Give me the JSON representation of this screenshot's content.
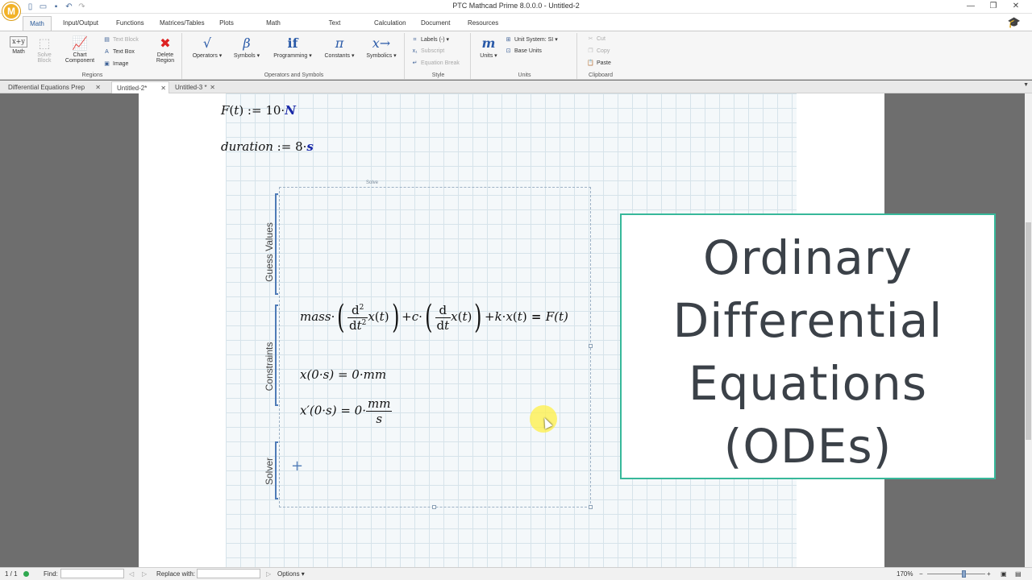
{
  "window": {
    "title": "PTC Mathcad Prime 8.0.0.0 - Untitled-2",
    "logo_letter": "M"
  },
  "ribbon_tabs": [
    {
      "label": "Math",
      "active": true
    },
    {
      "label": "Input/Output"
    },
    {
      "label": "Functions"
    },
    {
      "label": "Matrices/Tables"
    },
    {
      "label": "Plots"
    },
    {
      "label": "Math Formatting"
    },
    {
      "label": "Text Formatting"
    },
    {
      "label": "Calculation"
    },
    {
      "label": "Document"
    },
    {
      "label": "Resources"
    }
  ],
  "ribbon": {
    "regions": {
      "group_label": "Regions",
      "math": "Math",
      "solve_block": "Solve Block",
      "chart_component": "Chart Component",
      "text_block": "Text Block",
      "text_box": "Text Box",
      "image": "Image",
      "delete_region": "Delete Region"
    },
    "operators": {
      "group_label": "Operators and Symbols",
      "operators": "Operators",
      "symbols": "Symbols",
      "programming": "Programming",
      "constants": "Constants",
      "symbolics": "Symbolics",
      "operators_icon": "√",
      "symbols_icon": "β",
      "programming_icon": "if",
      "constants_icon": "π",
      "symbolics_icon": "x→"
    },
    "style": {
      "group_label": "Style",
      "labels": "Labels",
      "labels_value": "(-)",
      "subscript": "Subscript",
      "equation_break": "Equation Break"
    },
    "units": {
      "group_label": "Units",
      "units": "Units",
      "units_icon": "m",
      "unit_system": "Unit System:",
      "unit_system_value": "SI",
      "base_units": "Base Units"
    },
    "clipboard": {
      "group_label": "Clipboard",
      "cut": "Cut",
      "copy": "Copy",
      "paste": "Paste"
    }
  },
  "doc_tabs": [
    {
      "label": "Differential Equations Prep",
      "active": false
    },
    {
      "label": "Untitled-2*",
      "active": true
    },
    {
      "label": "Untitled-3 *",
      "active": false
    }
  ],
  "worksheet": {
    "eq_force": "F(t) := 10·N",
    "eq_duration": "duration := 8·s",
    "solve_label": "Solve",
    "guess_values": "Guess Values",
    "constraints": "Constraints",
    "solver": "Solver",
    "solver_placeholder": "+",
    "ode_mass": "mass",
    "ode_c": "c",
    "ode_k": "k",
    "ode_rhs": "F(t)",
    "ic1": "x(0·s) = 0·mm",
    "ic2_lhs": "x′(0·s) = 0·",
    "ic2_num": "mm",
    "ic2_den": "s"
  },
  "overlay": {
    "title_lines": [
      "Ordinary",
      "Differential",
      "Equations",
      "(ODEs)"
    ],
    "border_color": "#37b89a"
  },
  "status": {
    "page": "1 / 1",
    "find_label": "Find:",
    "replace_label": "Replace with:",
    "options_label": "Options",
    "zoom": "170%"
  }
}
